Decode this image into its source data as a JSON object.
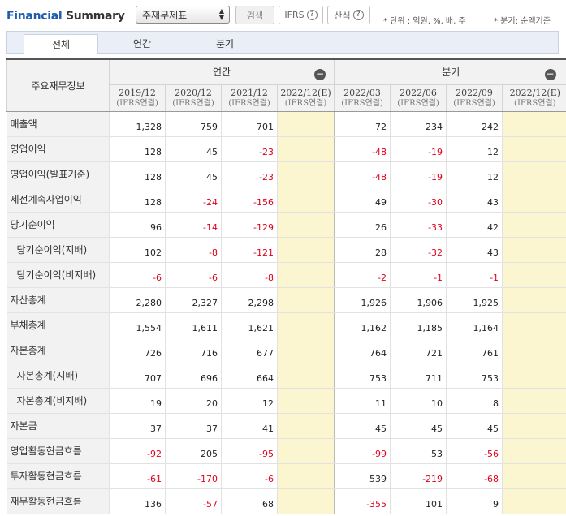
{
  "header": {
    "title_part1": "Financial",
    "title_part2": " Summary",
    "select_value": "주재무제표",
    "search_label": "검색",
    "ifrs_label": "IFRS",
    "calc_label": "산식",
    "help_glyph": "?",
    "unit_note": "* 단위 : 억원, %, 배, 주",
    "quarter_note": "* 분기: 순액기준"
  },
  "tabs": [
    {
      "label": "전체",
      "active": true
    },
    {
      "label": "연간",
      "active": false
    },
    {
      "label": "분기",
      "active": false
    }
  ],
  "table": {
    "row_header": "주요재무정보",
    "annual_group": "연간",
    "quarter_group": "분기",
    "collapse_glyph": "−",
    "periods": [
      {
        "period": "2019/12",
        "basis": "(IFRS연결)"
      },
      {
        "period": "2020/12",
        "basis": "(IFRS연결)"
      },
      {
        "period": "2021/12",
        "basis": "(IFRS연결)"
      },
      {
        "period": "2022/12(E)",
        "basis": "(IFRS연결)"
      },
      {
        "period": "2022/03",
        "basis": "(IFRS연결)"
      },
      {
        "period": "2022/06",
        "basis": "(IFRS연결)"
      },
      {
        "period": "2022/09",
        "basis": "(IFRS연결)"
      },
      {
        "period": "2022/12(E)",
        "basis": "(IFRS연결)"
      }
    ],
    "rows": [
      {
        "label": "매출액",
        "indent": false,
        "values": [
          "1,328",
          "759",
          "701",
          "",
          "72",
          "234",
          "242",
          ""
        ]
      },
      {
        "label": "영업이익",
        "indent": false,
        "values": [
          "128",
          "45",
          "-23",
          "",
          "-48",
          "-19",
          "12",
          ""
        ]
      },
      {
        "label": "영업이익(발표기준)",
        "indent": false,
        "values": [
          "128",
          "45",
          "-23",
          "",
          "-48",
          "-19",
          "12",
          ""
        ]
      },
      {
        "label": "세전계속사업이익",
        "indent": false,
        "values": [
          "128",
          "-24",
          "-156",
          "",
          "49",
          "-30",
          "43",
          ""
        ]
      },
      {
        "label": "당기순이익",
        "indent": false,
        "values": [
          "96",
          "-14",
          "-129",
          "",
          "26",
          "-33",
          "42",
          ""
        ]
      },
      {
        "label": "당기순이익(지배)",
        "indent": true,
        "values": [
          "102",
          "-8",
          "-121",
          "",
          "28",
          "-32",
          "43",
          ""
        ]
      },
      {
        "label": "당기순이익(비지배)",
        "indent": true,
        "values": [
          "-6",
          "-6",
          "-8",
          "",
          "-2",
          "-1",
          "-1",
          ""
        ]
      },
      {
        "label": "자산총계",
        "indent": false,
        "values": [
          "2,280",
          "2,327",
          "2,298",
          "",
          "1,926",
          "1,906",
          "1,925",
          ""
        ]
      },
      {
        "label": "부채총계",
        "indent": false,
        "values": [
          "1,554",
          "1,611",
          "1,621",
          "",
          "1,162",
          "1,185",
          "1,164",
          ""
        ]
      },
      {
        "label": "자본총계",
        "indent": false,
        "values": [
          "726",
          "716",
          "677",
          "",
          "764",
          "721",
          "761",
          ""
        ]
      },
      {
        "label": "자본총계(지배)",
        "indent": true,
        "values": [
          "707",
          "696",
          "664",
          "",
          "753",
          "711",
          "753",
          ""
        ]
      },
      {
        "label": "자본총계(비지배)",
        "indent": true,
        "values": [
          "19",
          "20",
          "12",
          "",
          "11",
          "10",
          "8",
          ""
        ]
      },
      {
        "label": "자본금",
        "indent": false,
        "values": [
          "37",
          "37",
          "41",
          "",
          "45",
          "45",
          "45",
          ""
        ]
      },
      {
        "label": "영업활동현금흐름",
        "indent": false,
        "values": [
          "-92",
          "205",
          "-95",
          "",
          "-99",
          "53",
          "-56",
          ""
        ]
      },
      {
        "label": "투자활동현금흐름",
        "indent": false,
        "values": [
          "-61",
          "-170",
          "-6",
          "",
          "539",
          "-219",
          "-68",
          ""
        ]
      },
      {
        "label": "재무활동현금흐름",
        "indent": false,
        "values": [
          "136",
          "-57",
          "68",
          "",
          "-355",
          "101",
          "9",
          ""
        ]
      }
    ]
  },
  "colors": {
    "negative": "#e0001b",
    "estimate_bg": "#fbf6cf",
    "title_blue": "#1d5dab"
  }
}
